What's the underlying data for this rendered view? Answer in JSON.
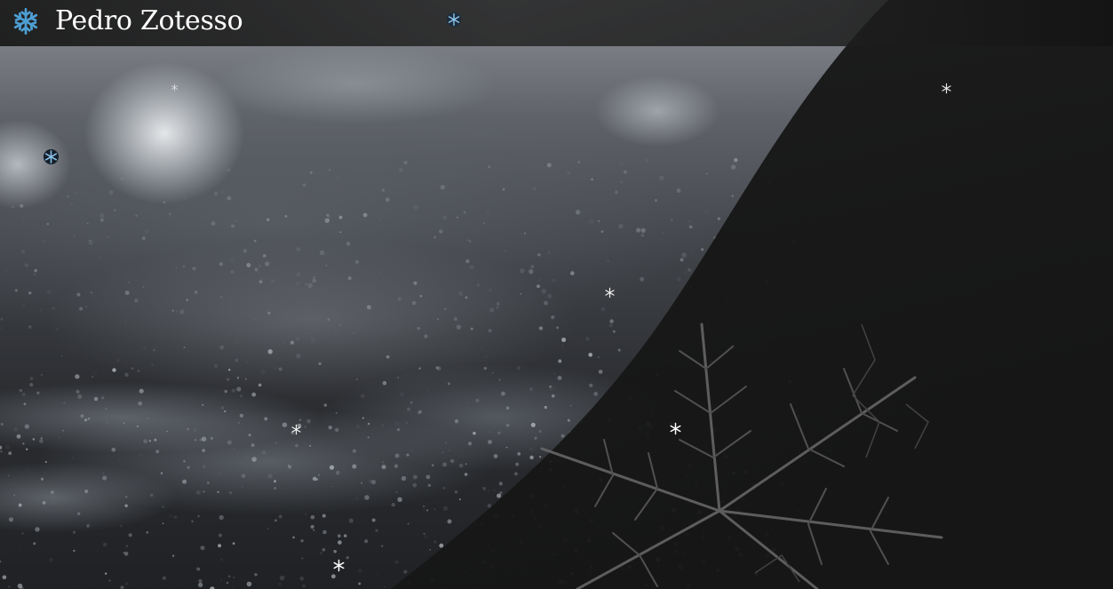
{
  "header": {
    "site_title": "Pedro Zotesso",
    "logo_icon": "snowflake-icon",
    "logo_color": "#4d9fd3"
  },
  "hero": {
    "background": "frosty-ground-photo",
    "overlay_color": "#161616",
    "decoration": "large-snowflake-crystal"
  },
  "falling_snowflakes": {
    "icon": "snowflake-icon",
    "colors": [
      "#ffffff",
      "#7fb8e0",
      "#1a2a3a"
    ]
  }
}
